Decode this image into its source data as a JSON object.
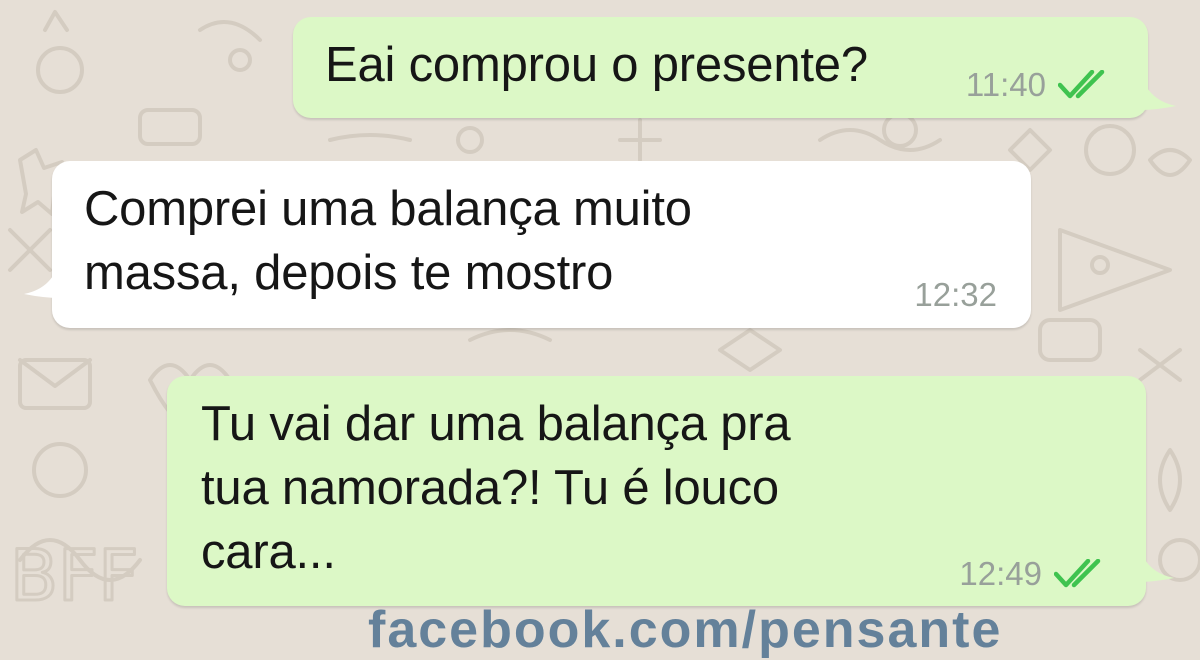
{
  "chat": {
    "messages": [
      {
        "direction": "outgoing",
        "text": "Eai comprou o presente?",
        "time": "11:40",
        "status": "read",
        "status_icon": "double-check-icon"
      },
      {
        "direction": "incoming",
        "text": "Comprei uma balança muito\nmassa, depois te mostro",
        "time": "12:32"
      },
      {
        "direction": "outgoing",
        "text": "Tu vai dar uma balança pra\ntua namorada?! Tu é louco\ncara...",
        "time": "12:49",
        "status": "read",
        "status_icon": "double-check-icon"
      }
    ]
  },
  "watermark": {
    "text": "facebook.com/pensante"
  },
  "colors": {
    "wallpaper": "#e6dfd6",
    "outgoing_bubble": "#dcf8c6",
    "incoming_bubble": "#ffffff",
    "read_tick": "#3fc34f",
    "timestamp": "#98a09a"
  }
}
